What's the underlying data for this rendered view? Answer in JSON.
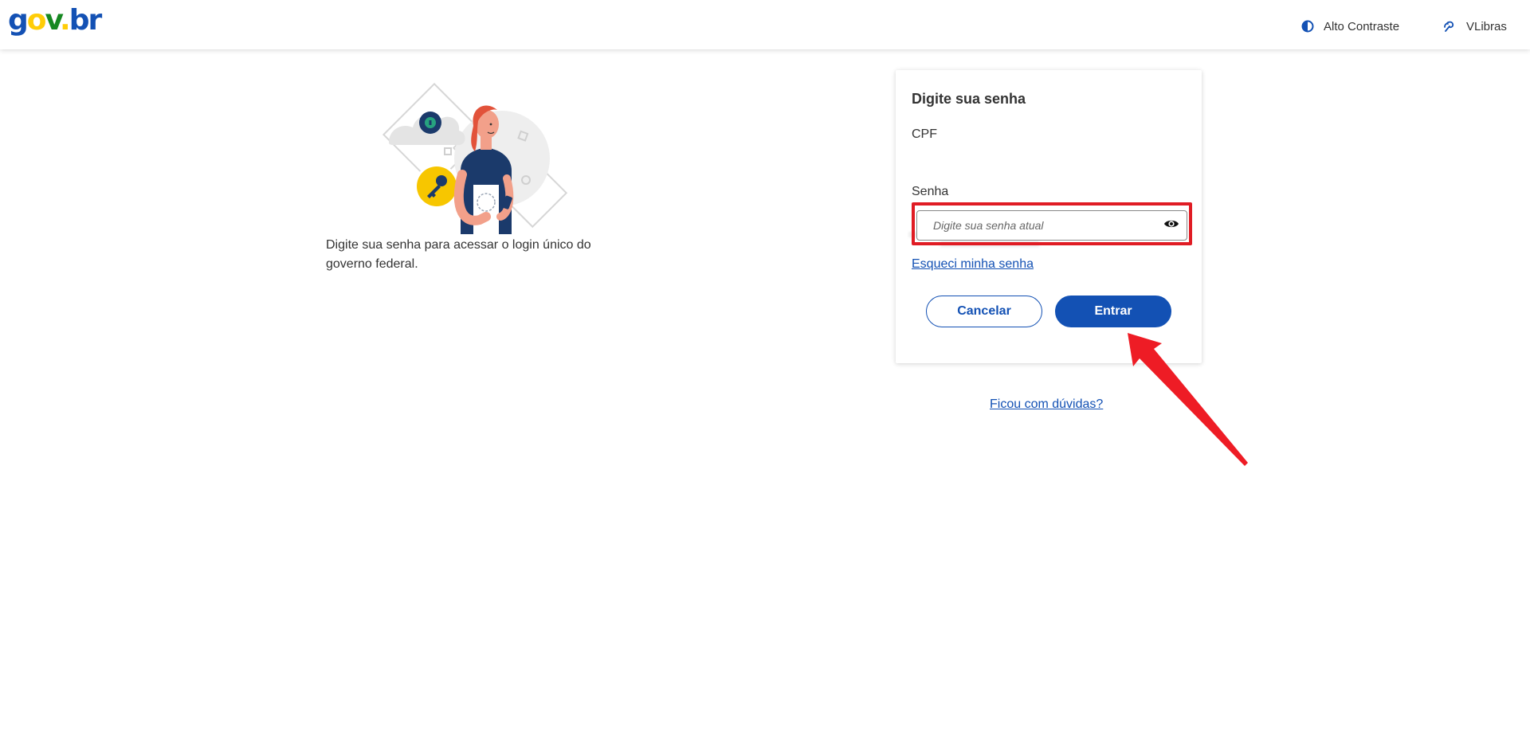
{
  "header": {
    "logo": {
      "g": "g",
      "o": "o",
      "v": "v",
      "dot": ".",
      "br": "br"
    },
    "contrast_label": "Alto Contraste",
    "contrast_icon": "contrast-half-circle-icon",
    "vlibras_label": "VLibras",
    "vlibras_icon": "hand-sign-icon"
  },
  "intro": {
    "description": "Digite sua senha para acessar o login único do governo federal."
  },
  "login_card": {
    "title": "Digite sua senha",
    "cpf_label": "CPF",
    "senha_label": "Senha",
    "password_placeholder": "Digite sua senha atual",
    "show_password_icon": "eye-icon",
    "forgot_link": "Esqueci minha senha",
    "cancel_button": "Cancelar",
    "enter_button": "Entrar"
  },
  "help_link": "Ficou com dúvidas?",
  "colors": {
    "primary": "#1351b4",
    "highlight_red": "#e01c24",
    "logo_yellow": "#ffcd07",
    "logo_green": "#168821"
  }
}
